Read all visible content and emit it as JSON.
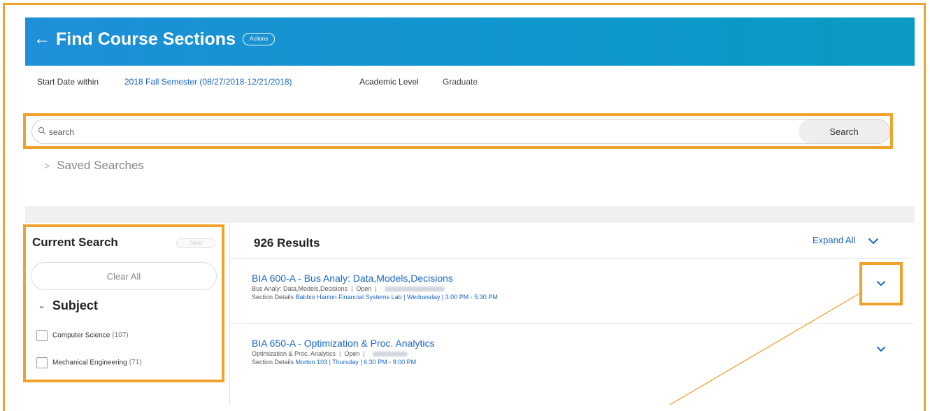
{
  "header": {
    "back_icon": "arrow-left-icon",
    "title": "Find Course Sections",
    "actions_label": "Actions"
  },
  "filters": {
    "start_date_label": "Start Date within",
    "start_date_value": "2018 Fall Semester (08/27/2018-12/21/2018)",
    "academic_level_label": "Academic Level",
    "academic_level_value": "Graduate"
  },
  "search": {
    "placeholder": "search",
    "value": "",
    "icon": "search-icon",
    "button_label": "Search"
  },
  "saved_searches": {
    "chevron": ">",
    "label": "Saved Searches"
  },
  "sidebar": {
    "title": "Current Search",
    "save_label": "Save",
    "clear_all_label": "Clear All",
    "subject": {
      "chevron": "⌄",
      "title": "Subject",
      "items": [
        {
          "label": "Computer Science",
          "count": "(107)",
          "checked": false
        },
        {
          "label": "Mechanical Engineering",
          "count": "(71)",
          "checked": false
        }
      ]
    }
  },
  "results": {
    "count_label": "926 Results",
    "expand_all_label": "Expand All",
    "items": [
      {
        "title": "BIA 600-A - Bus Analy: Data,Models,Decisions",
        "course": "Bus Analy: Data,Models,Decisions",
        "status": "Open",
        "details_label": "Section Details",
        "details_value": "Babbio Hanlon Financial Systems Lab | Wednesday | 3:00 PM - 5:30 PM"
      },
      {
        "title": "BIA 650-A - Optimization & Proc. Analytics",
        "course": "Optimization & Proc. Analytics",
        "status": "Open",
        "details_label": "Section Details",
        "details_value": "Morton 103 | Thursday | 6:30 PM - 9:00 PM"
      }
    ]
  },
  "colors": {
    "header_gradient_start": "#1f8fd8",
    "header_gradient_end": "#0a9ac2",
    "link": "#1a66c7",
    "highlight": "#f0a32c"
  }
}
